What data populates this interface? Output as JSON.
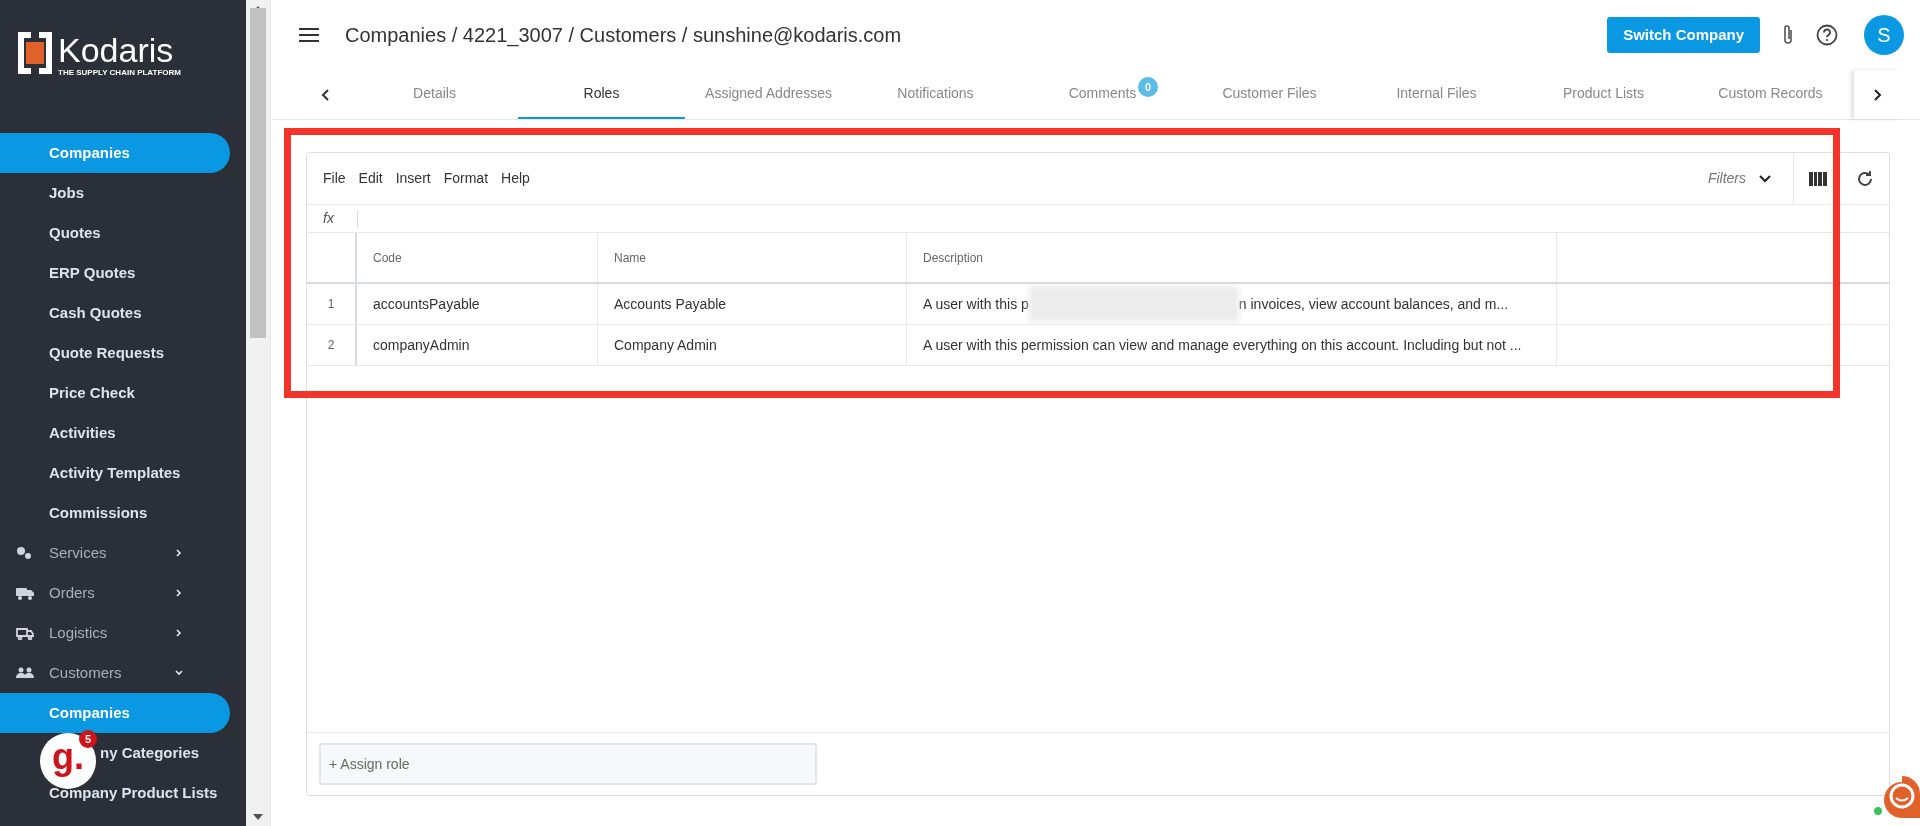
{
  "sidebar": {
    "items": [
      {
        "label": "Companies",
        "kind": "sub",
        "selected": true
      },
      {
        "label": "Jobs",
        "kind": "sub",
        "selected": false
      },
      {
        "label": "Quotes",
        "kind": "sub",
        "selected": false
      },
      {
        "label": "ERP Quotes",
        "kind": "sub",
        "selected": false
      },
      {
        "label": "Cash Quotes",
        "kind": "sub",
        "selected": false
      },
      {
        "label": "Quote Requests",
        "kind": "sub",
        "selected": false
      },
      {
        "label": "Price Check",
        "kind": "sub",
        "selected": false
      },
      {
        "label": "Activities",
        "kind": "sub",
        "selected": false
      },
      {
        "label": "Activity Templates",
        "kind": "sub",
        "selected": false
      },
      {
        "label": "Commissions",
        "kind": "sub",
        "selected": false
      },
      {
        "label": "Services",
        "kind": "section",
        "expanded": false
      },
      {
        "label": "Orders",
        "kind": "section",
        "expanded": false
      },
      {
        "label": "Logistics",
        "kind": "section",
        "expanded": false
      },
      {
        "label": "Customers",
        "kind": "section",
        "expanded": true
      },
      {
        "label": "Companies",
        "kind": "sub",
        "selected": true
      },
      {
        "label": "ny Categories",
        "kind": "sub",
        "selected": false,
        "obscured": true
      },
      {
        "label": "Company Product Lists",
        "kind": "sub",
        "selected": false
      }
    ],
    "badge": {
      "letter": "g.",
      "count": "5"
    }
  },
  "logo": {
    "name": "Kodaris",
    "tagline": "THE SUPPLY CHAIN PLATFORM"
  },
  "breadcrumb": "Companies / 4221_3007 / Customers / sunshine@kodaris.com",
  "header": {
    "switch_button": "Switch Company",
    "avatar": "S"
  },
  "tabs": [
    {
      "label": "Details",
      "selected": false
    },
    {
      "label": "Roles",
      "selected": true
    },
    {
      "label": "Assigned Addresses",
      "selected": false
    },
    {
      "label": "Notifications",
      "selected": false
    },
    {
      "label": "Comments",
      "selected": false,
      "badge": "0"
    },
    {
      "label": "Customer Files",
      "selected": false
    },
    {
      "label": "Internal Files",
      "selected": false
    },
    {
      "label": "Product Lists",
      "selected": false
    },
    {
      "label": "Custom Records",
      "selected": false
    }
  ],
  "grid": {
    "highlighted": true,
    "menu": [
      "File",
      "Edit",
      "Insert",
      "Format",
      "Help"
    ],
    "filters": "Filters",
    "formula_label": "fx",
    "columns": [
      "Code",
      "Name",
      "Description"
    ],
    "rows": [
      {
        "index": "1",
        "code": "accountsPayable",
        "name": "Accounts Payable",
        "description": "A user with this p",
        "description_after": "n invoices, view account balances, and m..."
      },
      {
        "index": "2",
        "code": "companyAdmin",
        "name": "Company Admin",
        "description": "A user with this permission can view and manage everything on this account. Including but not ..."
      }
    ],
    "assign_placeholder": "+ Assign role"
  }
}
